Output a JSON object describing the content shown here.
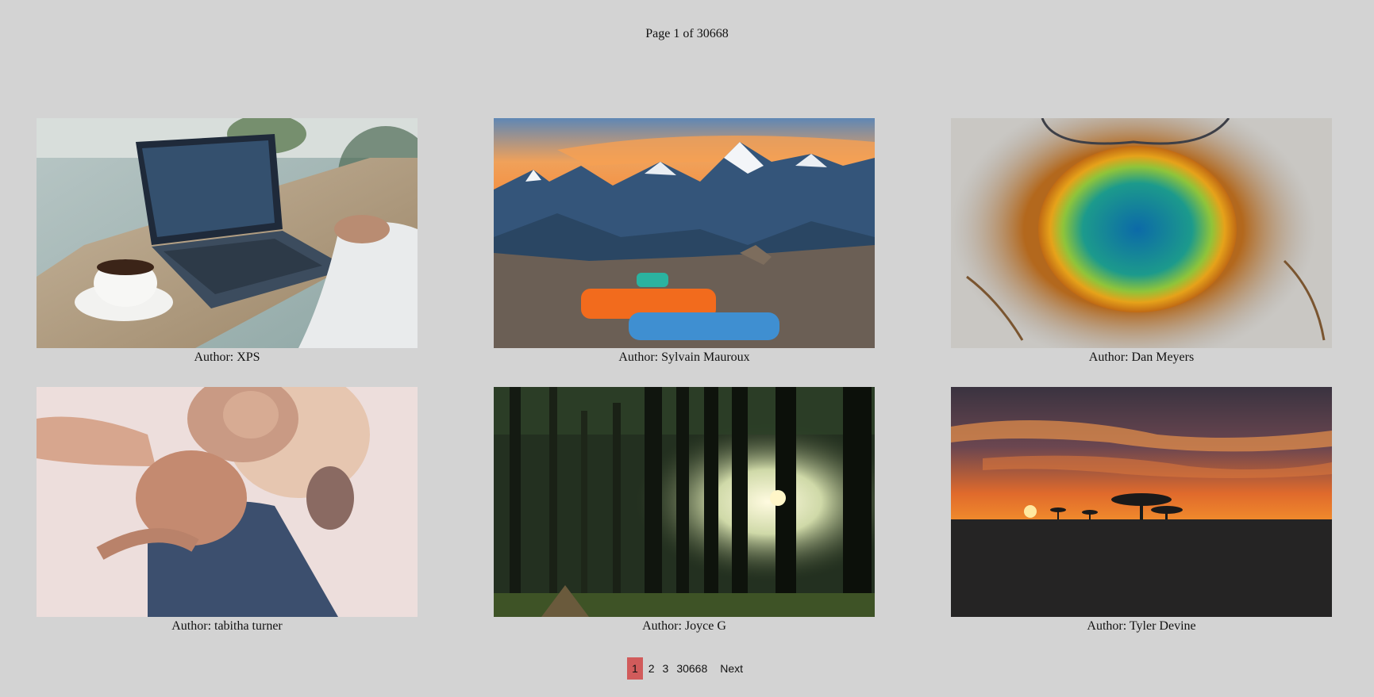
{
  "header": {
    "page_indicator": "Page 1 of 30668"
  },
  "gallery": {
    "items": [
      {
        "author": "Author: XPS"
      },
      {
        "author": "Author: Sylvain Mauroux"
      },
      {
        "author": "Author: Dan Meyers"
      },
      {
        "author": "Author: tabitha turner"
      },
      {
        "author": "Author: Joyce G"
      },
      {
        "author": "Author: Tyler Devine"
      }
    ]
  },
  "pagination": {
    "pages": [
      "1",
      "2",
      "3",
      "30668"
    ],
    "active": "1",
    "next_label": "Next",
    "active_color": "#d15b5b"
  }
}
